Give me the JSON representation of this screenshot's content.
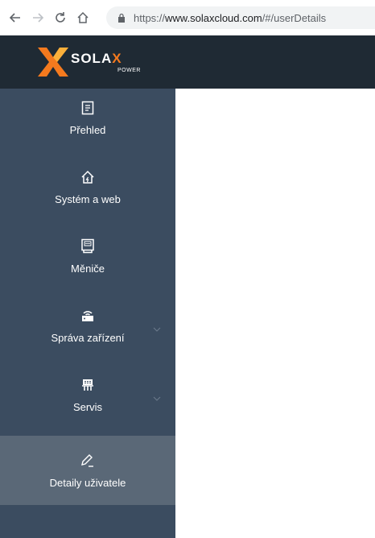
{
  "browser": {
    "url_scheme": "https://",
    "url_host": "www.solaxcloud.com",
    "url_path": "/#/userDetails"
  },
  "brand": {
    "name_main": "SOLA",
    "name_x": "X",
    "name_sub": "POWER",
    "accent_color": "#f57a1e"
  },
  "sidebar": {
    "items": [
      {
        "label": "Přehled",
        "icon": "overview-icon",
        "expandable": false,
        "active": false
      },
      {
        "label": "Systém a web",
        "icon": "home-icon",
        "expandable": false,
        "active": false
      },
      {
        "label": "Měniče",
        "icon": "inverter-icon",
        "expandable": false,
        "active": false
      },
      {
        "label": "Správa zařízení",
        "icon": "router-icon",
        "expandable": true,
        "active": false
      },
      {
        "label": "Servis",
        "icon": "service-icon",
        "expandable": true,
        "active": false
      },
      {
        "label": "Detaily uživatele",
        "icon": "edit-icon",
        "expandable": false,
        "active": true
      }
    ]
  }
}
